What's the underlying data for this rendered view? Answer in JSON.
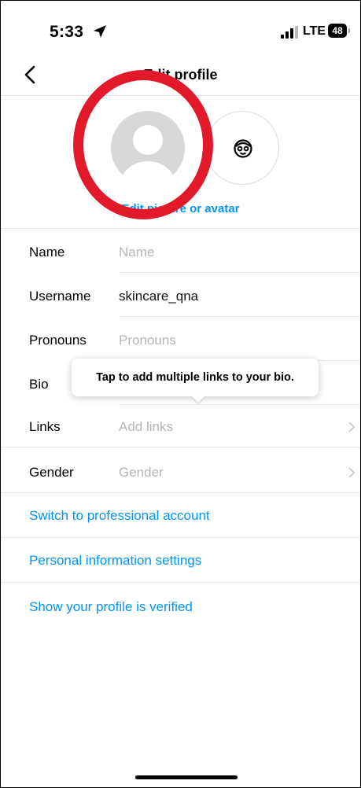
{
  "status_bar": {
    "time": "5:33",
    "network": "LTE",
    "battery": "48"
  },
  "header": {
    "title": "Edit profile"
  },
  "profile": {
    "edit_picture_label": "Edit picture or avatar"
  },
  "fields": [
    {
      "label": "Name",
      "value": "",
      "placeholder": "Name"
    },
    {
      "label": "Username",
      "value": "skincare_qna",
      "placeholder": ""
    },
    {
      "label": "Pronouns",
      "value": "",
      "placeholder": "Pronouns"
    },
    {
      "label": "Bio",
      "value": "",
      "placeholder": ""
    },
    {
      "label": "Links",
      "value": "",
      "placeholder": "Add links"
    },
    {
      "label": "Gender",
      "value": "",
      "placeholder": "Gender"
    }
  ],
  "tooltip": {
    "text": "Tap to add multiple links to your bio."
  },
  "links": {
    "professional": "Switch to professional account",
    "personal_info": "Personal information settings",
    "verified": "Show your profile is verified"
  },
  "colors": {
    "accent": "#0095f6",
    "highlight_ring": "#e2182b",
    "divider": "#e6e6e6"
  }
}
